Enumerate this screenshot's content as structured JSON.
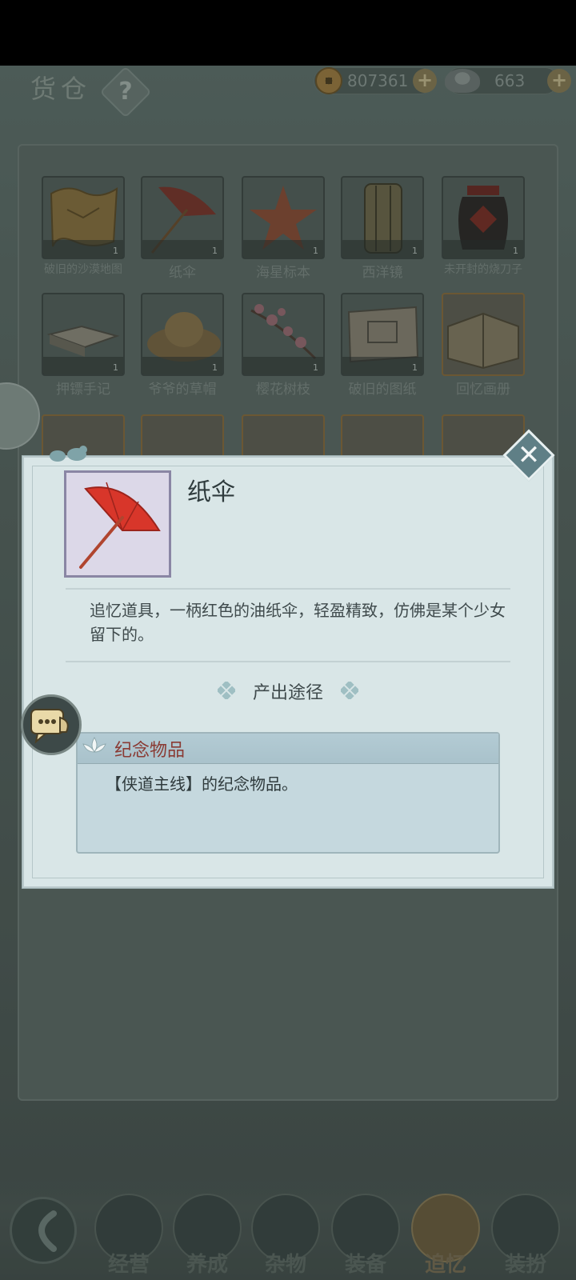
{
  "header": {
    "title": "货仓",
    "help_label": "?"
  },
  "currency": {
    "copper": "807361",
    "silver": "663",
    "plus_label": "+"
  },
  "inventory": {
    "items": [
      {
        "name": "破旧的沙漠地图",
        "count": "1",
        "icon": "map-icon"
      },
      {
        "name": "纸伞",
        "count": "1",
        "icon": "umbrella-icon"
      },
      {
        "name": "海星标本",
        "count": "1",
        "icon": "starfish-icon"
      },
      {
        "name": "西洋镜",
        "count": "1",
        "icon": "peepshow-icon"
      },
      {
        "name": "未开封的烧刀子",
        "count": "1",
        "icon": "wine-jar-icon"
      },
      {
        "name": "押镖手记",
        "count": "1",
        "icon": "book-icon"
      },
      {
        "name": "爷爷的草帽",
        "count": "1",
        "icon": "straw-hat-icon"
      },
      {
        "name": "樱花树枝",
        "count": "1",
        "icon": "cherry-branch-icon"
      },
      {
        "name": "破旧的图纸",
        "count": "1",
        "icon": "blueprint-icon"
      },
      {
        "name": "回忆画册",
        "count": "",
        "icon": "album-icon"
      }
    ]
  },
  "dialog": {
    "item_name": "纸伞",
    "description": "追忆道具，一柄红色的油纸伞，轻盈精致，仿佛是某个少女留下的。",
    "source_header": "产出途径",
    "source": {
      "title": "纪念物品",
      "detail": "【侠道主线】的纪念物品。"
    },
    "close_label": "✕"
  },
  "nav": {
    "items": [
      {
        "label": "经营",
        "icon": "bowl-icon"
      },
      {
        "label": "养成",
        "icon": "scroll-book-icon"
      },
      {
        "label": "杂物",
        "icon": "bundle-icon"
      },
      {
        "label": "装备",
        "icon": "robe-icon"
      },
      {
        "label": "追忆",
        "icon": "letter-icon",
        "active": true
      },
      {
        "label": "装扮",
        "icon": "pavilion-icon"
      }
    ]
  },
  "colors": {
    "dialog_bg": "#d9e6e7",
    "source_title": "#8a3b34",
    "umbrella_red": "#d8362a"
  }
}
